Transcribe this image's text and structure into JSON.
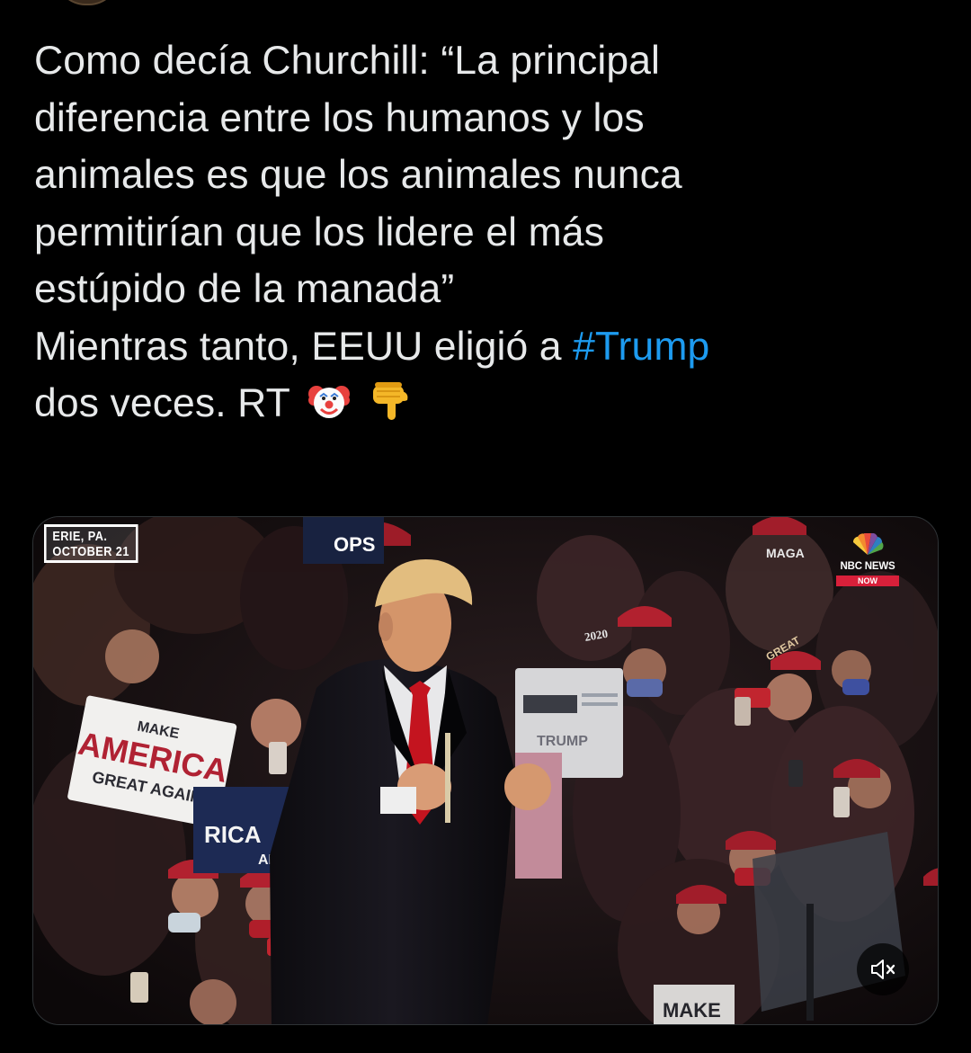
{
  "tweet": {
    "text_lines": [
      "Como decía Churchill: “La principal",
      "diferencia entre los humanos y los",
      "animales es que los animales nunca",
      "permitirían que los lidere el más",
      "estúpido de la manada”",
      "Mientras tanto, EEUU eligió a "
    ],
    "hashtag": "#Trump",
    "last_line": "dos veces. RT",
    "emojis": [
      "clown-face-emoji",
      "backhand-index-pointing-down-emoji"
    ],
    "hashtag_color": "#1d9bf0",
    "text_color": "#e7e9ea",
    "background": "#000000"
  },
  "media": {
    "location_line1": "ERIE, PA.",
    "location_line2": "OCTOBER 21",
    "network_logo_line1": "NBC NEWS",
    "network_logo_line2": "NOW",
    "sign_main_line1": "MAKE",
    "sign_main_line2": "AMERICA",
    "sign_main_line3": "GREAT AGAIN",
    "sign_partial": "RICA",
    "sign_partial2": "AIN",
    "sign_top": "OPS",
    "sign_trump": "TRUMP",
    "sign_bottom": "MAKE",
    "hat_text": "MAGA",
    "hat_year": "2020",
    "hat_great": "GREAT",
    "mute_icon": "speaker-muted-icon"
  }
}
